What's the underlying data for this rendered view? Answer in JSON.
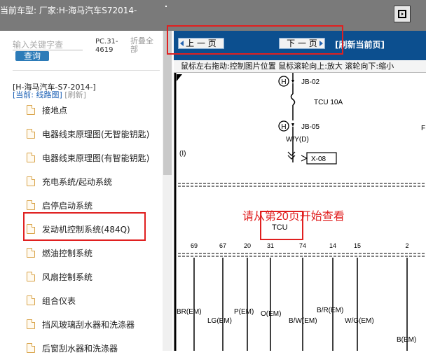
{
  "header": {
    "title": "当前车型:  厂家:H-海马汽车S72014-",
    "expand_icon": "window-toggle-icon"
  },
  "sidebar": {
    "search_placeholder": "输入关键字查",
    "query_label": "查询",
    "pc_code": "PC.31-4619",
    "collapse_label": "折叠全部",
    "car_model": "[H-海马汽车-S7-2014-]",
    "current_label": "[当前: 线路图]",
    "refresh_label": "[刷新]",
    "items": [
      {
        "label": "接地点"
      },
      {
        "label": "电器线束原理图(无智能钥匙)"
      },
      {
        "label": "电器线束原理图(有智能钥匙)"
      },
      {
        "label": "充电系统/起动系统"
      },
      {
        "label": "启停启动系统"
      },
      {
        "label": "发动机控制系统(484Q)"
      },
      {
        "label": "燃油控制系统"
      },
      {
        "label": "风扇控制系统"
      },
      {
        "label": "组合仪表"
      },
      {
        "label": "挡风玻璃刮水器和洗涤器"
      },
      {
        "label": "后窗刮水器和洗涤器"
      }
    ]
  },
  "viewer": {
    "prev_label": "上 一 页",
    "next_label": "下 一 页",
    "refresh_page": "[刷新当前页]",
    "hint": "鼠标左右拖动:控制图片位置  鼠标滚轮向上:放大  滚轮向下:缩小",
    "start_note": "请从第20页开始查看"
  },
  "diagram": {
    "labels": {
      "jb02": "JB-02",
      "tcu10a": "TCU 10A",
      "jb05": "JB-05",
      "wyd": "W/Y(D)",
      "x08": "X-08",
      "h": "H",
      "i": "(I)",
      "tcu": "TCU",
      "right_letter": "F"
    },
    "pins": [
      "69",
      "67",
      "20",
      "31",
      "74",
      "14",
      "15",
      "2"
    ],
    "wires": [
      "BR(EM)",
      "LG(EM)",
      "P(EM)",
      "O(EM)",
      "B/W(EM)",
      "B/R(EM)",
      "W/G(EM)",
      "B(EM)"
    ]
  }
}
